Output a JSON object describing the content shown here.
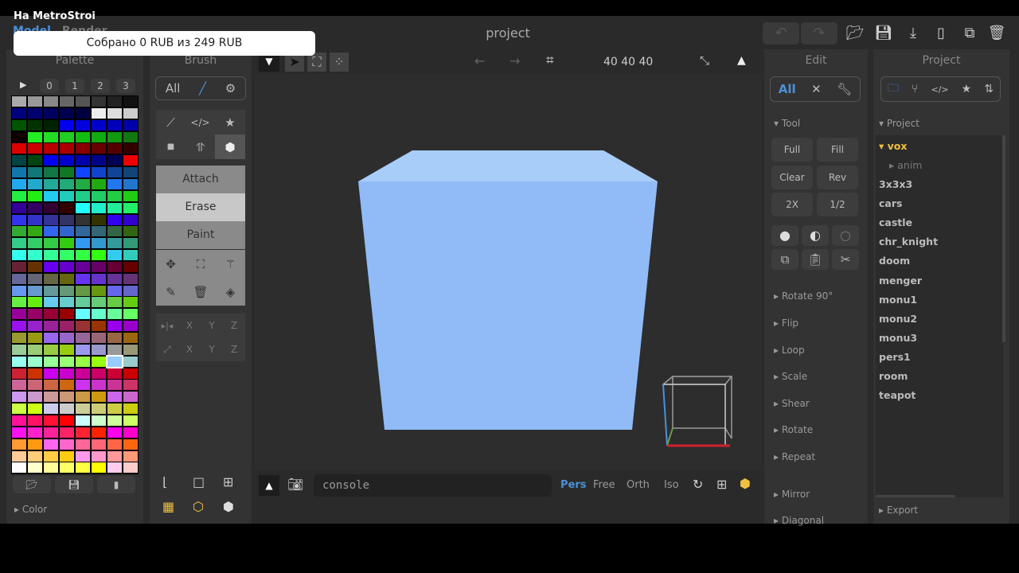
{
  "overlay": {
    "stream_title": "На MetroStroi",
    "donation_toast": "Собрано 0 RUB из 249 RUB"
  },
  "header": {
    "tabs": [
      "Model",
      "Render"
    ],
    "title": "project",
    "undo_icon": "undo-icon",
    "redo_icon": "redo-icon",
    "file_icons": [
      "open-folder-icon",
      "save-icon",
      "export-icon",
      "new-file-icon",
      "duplicate-icon",
      "trash-icon"
    ]
  },
  "palette": {
    "title": "Palette",
    "pages": [
      "0",
      "1",
      "2",
      "3"
    ],
    "selected_color": "#99ccff",
    "color_section": "Color",
    "colors": [
      [
        "#aaaaaa",
        "#999999",
        "#888888",
        "#666666",
        "#555555",
        "#333333",
        "#222222",
        "#111111"
      ],
      [
        "#000080",
        "#000070",
        "#000060",
        "#000050",
        "#000040",
        "#eeeeee",
        "#dddddd",
        "#cccccc"
      ],
      [
        "#005500",
        "#003300",
        "#002200",
        "#0000ee",
        "#0000dd",
        "#0000cc",
        "#0000bb",
        "#0000aa"
      ],
      [
        "#110000",
        "#22ee22",
        "#22dd22",
        "#22cc22",
        "#11bb11",
        "#11aa11",
        "#119911",
        "#117711"
      ],
      [
        "#dd0000",
        "#cc0000",
        "#bb0000",
        "#aa0000",
        "#880000",
        "#660000",
        "#550000",
        "#330000"
      ],
      [
        "#004444",
        "#004411",
        "#0000ee",
        "#0000cc",
        "#0000aa",
        "#000088",
        "#000055",
        "#ee0000"
      ],
      [
        "#1177aa",
        "#117777",
        "#117744",
        "#117722",
        "#1144ff",
        "#1144cc",
        "#114499",
        "#114477"
      ],
      [
        "#22aaee",
        "#22aacc",
        "#22aa99",
        "#22aa77",
        "#22aa44",
        "#22aa11",
        "#2277ee",
        "#2277cc"
      ],
      [
        "#22ee44",
        "#22ee11",
        "#22ccee",
        "#22ccbb",
        "#22cc88",
        "#22cc66",
        "#22cc44",
        "#22cc11"
      ],
      [
        "#330099",
        "#330066",
        "#330033",
        "#330000",
        "#22ffff",
        "#22eecc",
        "#22ee99",
        "#22ee66"
      ],
      [
        "#3333ee",
        "#3333cc",
        "#333399",
        "#333366",
        "#333333",
        "#333300",
        "#3300ee",
        "#3300cc"
      ],
      [
        "#33aa33",
        "#33aa11",
        "#3366ee",
        "#3366cc",
        "#336699",
        "#336677",
        "#336644",
        "#336611"
      ],
      [
        "#33cc88",
        "#33cc66",
        "#33cc44",
        "#33cc11",
        "#3399ee",
        "#3399cc",
        "#339999",
        "#339977"
      ],
      [
        "#33ffee",
        "#33ffcc",
        "#33ff99",
        "#33ff66",
        "#33ff44",
        "#33ff11",
        "#33ccee",
        "#33ccbb"
      ],
      [
        "#662233",
        "#663300",
        "#6600ee",
        "#6600cc",
        "#660099",
        "#660066",
        "#660033",
        "#660000"
      ],
      [
        "#666699",
        "#666677",
        "#666644",
        "#666611",
        "#6633ee",
        "#6633cc",
        "#663399",
        "#663377"
      ],
      [
        "#6699ee",
        "#6699cc",
        "#669999",
        "#669977",
        "#669944",
        "#669911",
        "#6666ee",
        "#6666cc"
      ],
      [
        "#66ee44",
        "#66ee11",
        "#66ccee",
        "#66cccc",
        "#66cc99",
        "#66cc77",
        "#66cc44",
        "#66cc11"
      ],
      [
        "#990099",
        "#990066",
        "#990033",
        "#990000",
        "#66ffff",
        "#66ffcc",
        "#66ff99",
        "#66ff66"
      ],
      [
        "#9911ee",
        "#9922cc",
        "#992299",
        "#992266",
        "#993333",
        "#993300",
        "#9900ee",
        "#9900cc"
      ],
      [
        "#999933",
        "#999911",
        "#9966ee",
        "#9966cc",
        "#996699",
        "#996677",
        "#996644",
        "#996611"
      ],
      [
        "#99cc99",
        "#99cc77",
        "#99cc44",
        "#99cc11",
        "#9999ee",
        "#9999cc",
        "#999999",
        "#999977"
      ],
      [
        "#99ffee",
        "#99ffcc",
        "#99ff99",
        "#99ff77",
        "#99ff44",
        "#99ff11",
        "#99ccff",
        "#99cccc"
      ],
      [
        "#cc2233",
        "#cc3300",
        "#cc00ee",
        "#cc00cc",
        "#cc0099",
        "#cc0066",
        "#cc0033",
        "#cc0000"
      ],
      [
        "#cc6699",
        "#cc6677",
        "#cc6644",
        "#cc6611",
        "#cc33ee",
        "#cc33cc",
        "#cc3399",
        "#cc3366"
      ],
      [
        "#cc99ee",
        "#cc99cc",
        "#cc9999",
        "#cc9977",
        "#cc9944",
        "#cc9911",
        "#cc66ee",
        "#cc66cc"
      ],
      [
        "#ccff44",
        "#ccff11",
        "#ccccee",
        "#cccccc",
        "#cccc99",
        "#cccc77",
        "#cccc44",
        "#cccc11"
      ],
      [
        "#ff1199",
        "#ff1166",
        "#ff1133",
        "#ff0000",
        "#ccffff",
        "#ccffcc",
        "#ccff99",
        "#ccff66"
      ],
      [
        "#ff11ee",
        "#ff22cc",
        "#ff2299",
        "#ff2266",
        "#ff2233",
        "#ff2200",
        "#ff00ee",
        "#ff00cc"
      ],
      [
        "#ff9933",
        "#ff9911",
        "#ff66ee",
        "#ff66cc",
        "#ff6699",
        "#ff6677",
        "#ff6644",
        "#ff6611"
      ],
      [
        "#ffcc99",
        "#ffcc77",
        "#ffcc44",
        "#ffcc11",
        "#ff99ee",
        "#ff99cc",
        "#ff9999",
        "#ff9977"
      ],
      [
        "#ffffff",
        "#ffffcc",
        "#ffff99",
        "#ffff66",
        "#ffff44",
        "#ffff00",
        "#ffccee",
        "#ffcccc"
      ]
    ]
  },
  "brush": {
    "title": "Brush",
    "filter_all": "All",
    "modes": [
      "Attach",
      "Erase",
      "Paint"
    ],
    "active_mode": "Erase",
    "axis_labels": [
      "X",
      "Y",
      "Z"
    ]
  },
  "viewport": {
    "size": "40 40 40",
    "console_placeholder": "console",
    "views": [
      "Pers",
      "Free",
      "Orth",
      "Iso"
    ],
    "active_view": "Pers",
    "cube_top_color": "#a8cdf8",
    "cube_front_color": "#90bbf6"
  },
  "edit": {
    "title": "Edit",
    "filter_all": "All",
    "tool_section": "Tool",
    "buttons": [
      "Full",
      "Fill",
      "Clear",
      "Rev",
      "2X",
      "1/2"
    ],
    "sections": [
      "Rotate 90°",
      "Flip",
      "Loop",
      "Scale",
      "Shear",
      "Rotate",
      "Repeat",
      "Mirror",
      "Diagonal"
    ]
  },
  "project": {
    "title": "Project",
    "section": "Project",
    "folder": "vox",
    "subfolder": "anim",
    "files": [
      "3x3x3",
      "cars",
      "castle",
      "chr_knight",
      "doom",
      "menger",
      "monu1",
      "monu2",
      "monu3",
      "pers1",
      "room",
      "teapot"
    ],
    "export_section": "Export"
  }
}
